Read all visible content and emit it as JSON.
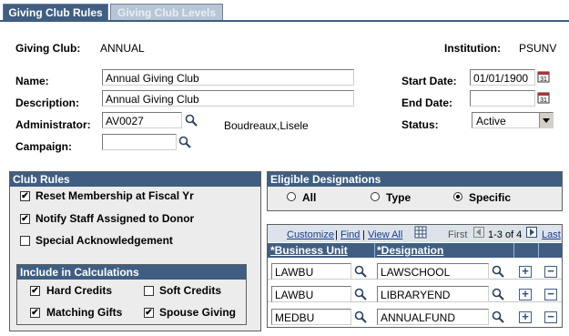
{
  "tabs": [
    {
      "label": "Giving Club Rules",
      "active": true
    },
    {
      "label": "Giving Club Levels",
      "active": false
    }
  ],
  "header": {
    "giving_club_label": "Giving Club:",
    "giving_club_value": "ANNUAL",
    "institution_label": "Institution:",
    "institution_value": "PSUNV"
  },
  "form": {
    "name_label": "Name:",
    "name_value": "Annual Giving Club",
    "description_label": "Description:",
    "description_value": "Annual Giving Club",
    "administrator_label": "Administrator:",
    "administrator_value": "AV0027",
    "administrator_name": "Boudreaux,Lisele",
    "campaign_label": "Campaign:",
    "campaign_value": "",
    "start_date_label": "Start Date:",
    "start_date_value": "01/01/1900",
    "end_date_label": "End Date:",
    "end_date_value": "",
    "status_label": "Status:",
    "status_value": "Active"
  },
  "club_rules": {
    "title": "Club Rules",
    "items": [
      {
        "label": "Reset Membership at Fiscal Yr",
        "checked": true
      },
      {
        "label": "Notify Staff Assigned to Donor",
        "checked": true
      },
      {
        "label": "Special Acknowledgement",
        "checked": false
      }
    ],
    "calc_title": "Include in Calculations",
    "calc_items": [
      {
        "label": "Hard Credits",
        "checked": true
      },
      {
        "label": "Soft Credits",
        "checked": false
      },
      {
        "label": "Matching Gifts",
        "checked": true
      },
      {
        "label": "Spouse Giving",
        "checked": true
      }
    ]
  },
  "eligible": {
    "title": "Eligible Designations",
    "options": [
      {
        "label": "All",
        "selected": false
      },
      {
        "label": "Type",
        "selected": false
      },
      {
        "label": "Specific",
        "selected": true
      }
    ]
  },
  "grid": {
    "customize": "Customize",
    "find": "Find",
    "view_all": "View All",
    "sep": "|",
    "first": "First",
    "range": "1-3 of 4",
    "last": "Last",
    "col_business_unit": "*Business Unit",
    "col_designation": "*Designation",
    "rows": [
      {
        "business_unit": "LAWBU",
        "designation": "LAWSCHOOL"
      },
      {
        "business_unit": "LAWBU",
        "designation": "LIBRARYEND"
      },
      {
        "business_unit": "MEDBU",
        "designation": "ANNUALFUND"
      }
    ]
  }
}
